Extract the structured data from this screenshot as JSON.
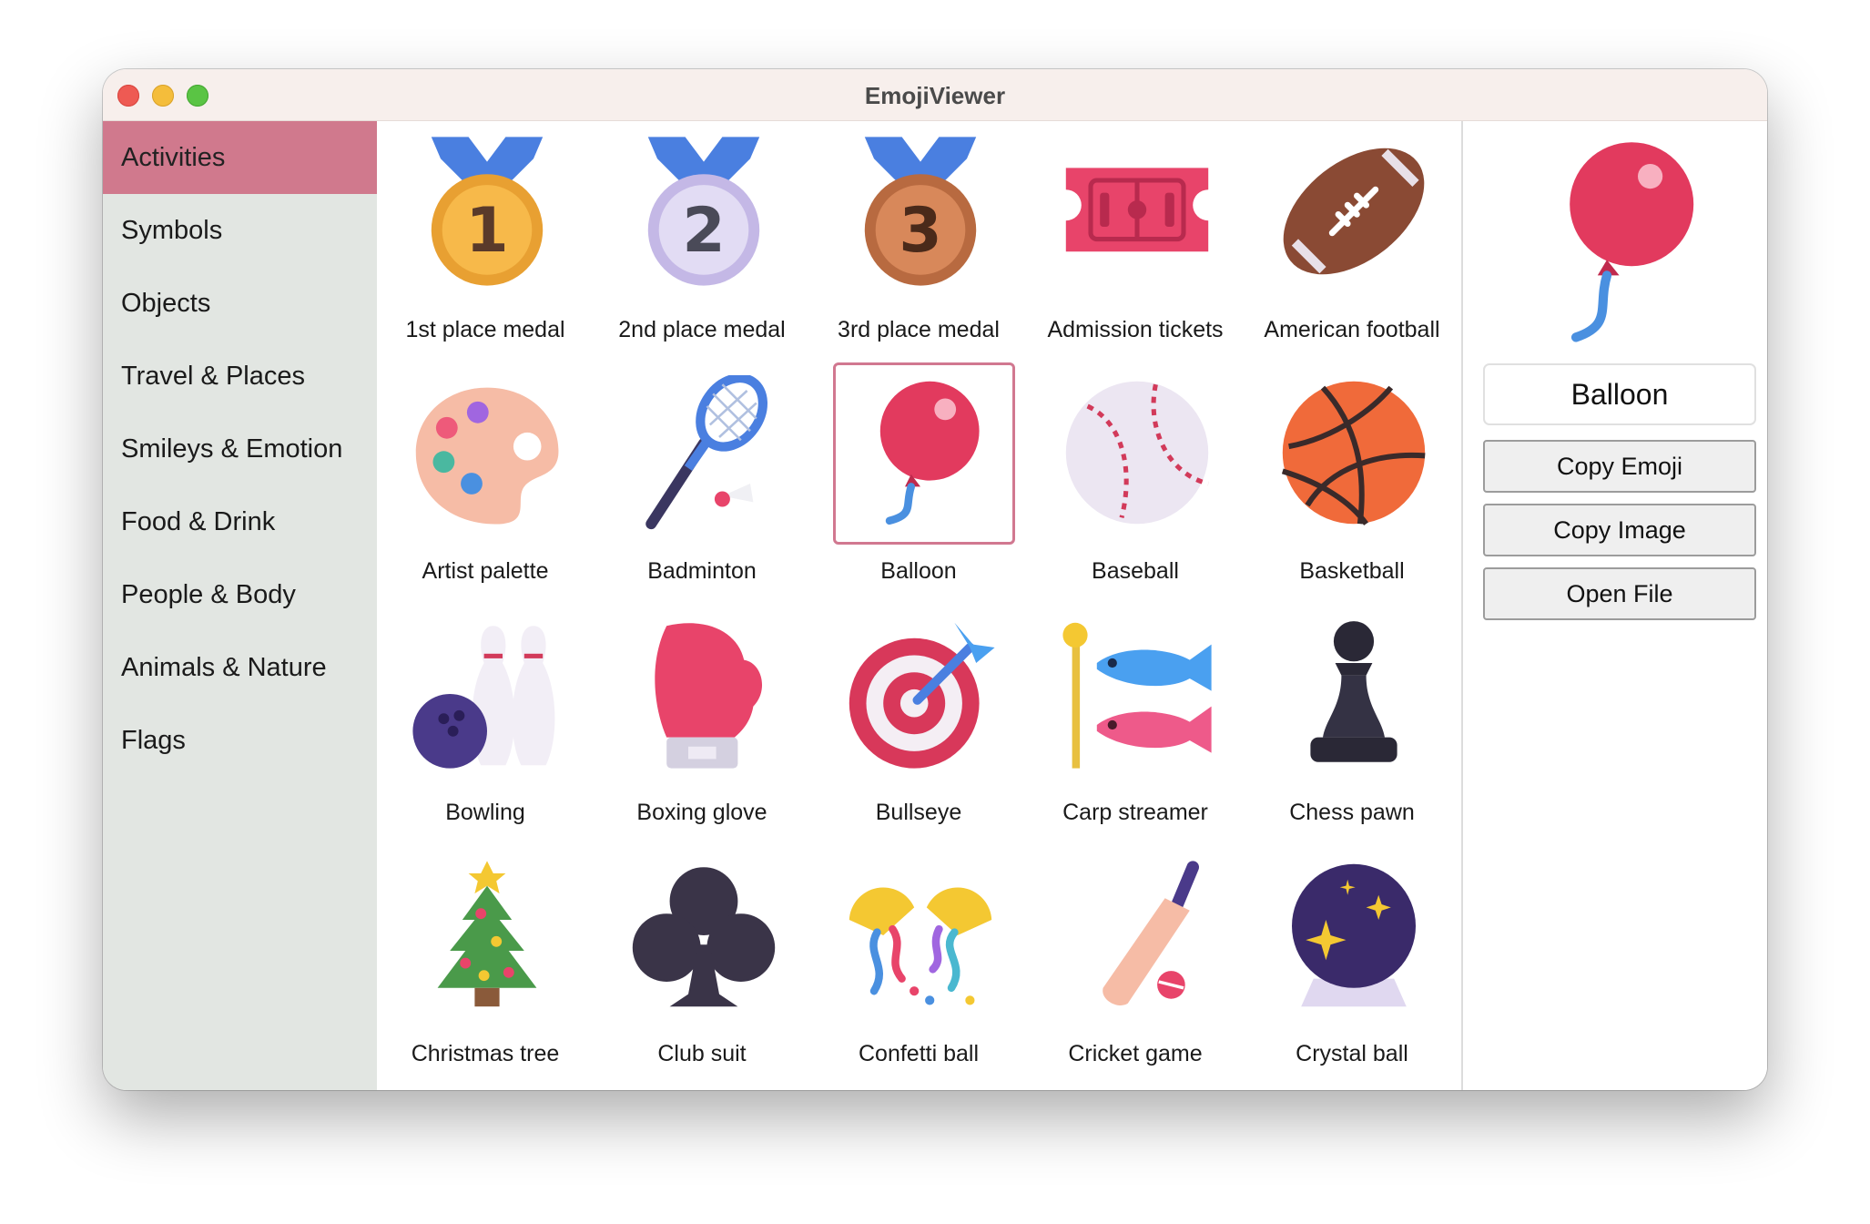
{
  "window": {
    "title": "EmojiViewer"
  },
  "sidebar": {
    "items": [
      {
        "label": "Activities",
        "active": true
      },
      {
        "label": "Symbols"
      },
      {
        "label": "Objects"
      },
      {
        "label": "Travel & Places"
      },
      {
        "label": "Smileys & Emotion"
      },
      {
        "label": "Food & Drink"
      },
      {
        "label": "People & Body"
      },
      {
        "label": "Animals & Nature"
      },
      {
        "label": "Flags"
      }
    ]
  },
  "grid": {
    "items": [
      {
        "label": "1st place medal",
        "icon": "first-place-medal-icon"
      },
      {
        "label": "2nd place medal",
        "icon": "second-place-medal-icon"
      },
      {
        "label": "3rd place medal",
        "icon": "third-place-medal-icon"
      },
      {
        "label": "Admission tickets",
        "icon": "admission-tickets-icon"
      },
      {
        "label": "American football",
        "icon": "american-football-icon"
      },
      {
        "label": "Artist palette",
        "icon": "artist-palette-icon"
      },
      {
        "label": "Badminton",
        "icon": "badminton-icon"
      },
      {
        "label": "Balloon",
        "icon": "balloon-icon",
        "selected": true
      },
      {
        "label": "Baseball",
        "icon": "baseball-icon"
      },
      {
        "label": "Basketball",
        "icon": "basketball-icon"
      },
      {
        "label": "Bowling",
        "icon": "bowling-icon"
      },
      {
        "label": "Boxing glove",
        "icon": "boxing-glove-icon"
      },
      {
        "label": "Bullseye",
        "icon": "bullseye-icon"
      },
      {
        "label": "Carp streamer",
        "icon": "carp-streamer-icon"
      },
      {
        "label": "Chess pawn",
        "icon": "chess-pawn-icon"
      },
      {
        "label": "Christmas tree",
        "icon": "christmas-tree-icon"
      },
      {
        "label": "Club suit",
        "icon": "club-suit-icon"
      },
      {
        "label": "Confetti ball",
        "icon": "confetti-ball-icon"
      },
      {
        "label": "Cricket game",
        "icon": "cricket-game-icon"
      },
      {
        "label": "Crystal ball",
        "icon": "crystal-ball-icon"
      }
    ]
  },
  "detail": {
    "selected_name": "Balloon",
    "preview_icon": "balloon-icon",
    "copy_emoji_label": "Copy Emoji",
    "copy_image_label": "Copy Image",
    "open_file_label": "Open File"
  },
  "colors": {
    "sidebar_active": "#d0798d",
    "selection_border": "#d17890",
    "sidebar_bg": "#e2e6e2",
    "titlebar_bg": "#f7efec"
  }
}
